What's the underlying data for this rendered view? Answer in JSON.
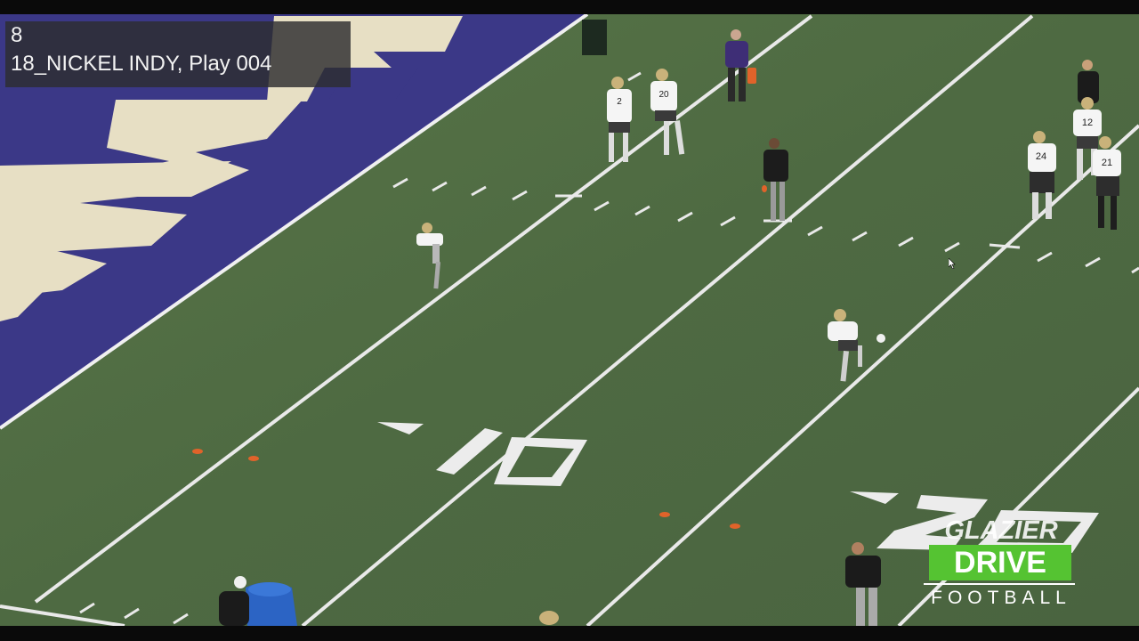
{
  "overlay": {
    "clip_number": "8",
    "play_label": "18_NICKEL INDY, Play 004"
  },
  "field": {
    "yard_numbers": [
      "10",
      "20"
    ],
    "endzone_text": "HUSKIES",
    "turf_color": "#4f6b43",
    "endzone_color": "#3d3a8c"
  },
  "players": {
    "jersey_numbers": [
      "2",
      "20",
      "24",
      "12",
      "21"
    ]
  },
  "logo": {
    "top": "GLAZIER",
    "middle": "DRIVE",
    "bottom": "FOOTBALL",
    "accent_color": "#55c332"
  },
  "cursor": {
    "icon": "mouse-pointer-icon"
  }
}
